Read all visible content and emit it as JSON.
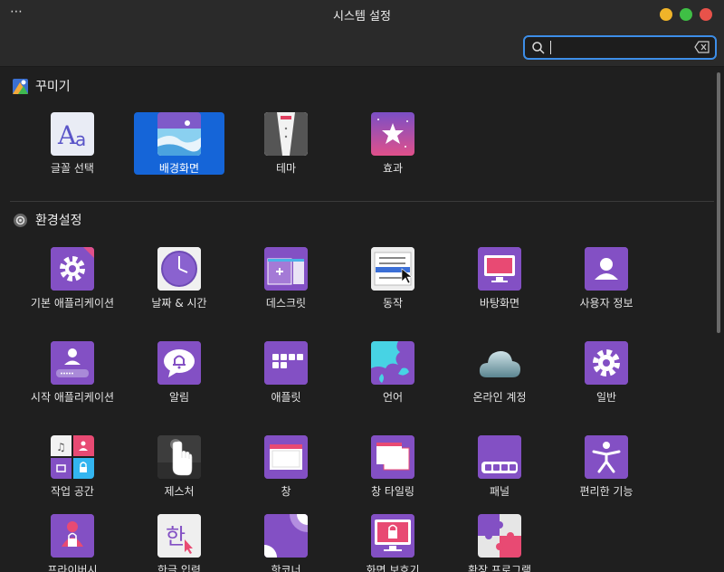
{
  "window": {
    "menu_label": "⋯",
    "title": "시스템 설정"
  },
  "search": {
    "value": "",
    "placeholder": ""
  },
  "sections": {
    "appearance": {
      "title": "꾸미기",
      "items": [
        {
          "label": "글꼴 선택",
          "icon": "font-aa-icon"
        },
        {
          "label": "배경화면",
          "icon": "wallpaper-icon",
          "selected": true
        },
        {
          "label": "테마",
          "icon": "tuxedo-theme-icon"
        },
        {
          "label": "효과",
          "icon": "star-effects-icon"
        }
      ]
    },
    "preferences": {
      "title": "환경설정",
      "items": [
        {
          "label": "기본 애플리케이션",
          "icon": "default-apps-gear-icon"
        },
        {
          "label": "날짜 & 시간",
          "icon": "clock-icon"
        },
        {
          "label": "데스크릿",
          "icon": "desklet-icon"
        },
        {
          "label": "동작",
          "icon": "actions-list-icon"
        },
        {
          "label": "바탕화면",
          "icon": "desktop-monitor-icon"
        },
        {
          "label": "사용자 정보",
          "icon": "user-info-icon"
        },
        {
          "label": "시작 애플리케이션",
          "icon": "startup-apps-icon"
        },
        {
          "label": "알림",
          "icon": "notification-bell-icon"
        },
        {
          "label": "애플릿",
          "icon": "applets-icon"
        },
        {
          "label": "언어",
          "icon": "language-map-icon"
        },
        {
          "label": "온라인 계정",
          "icon": "online-accounts-cloud-icon"
        },
        {
          "label": "일반",
          "icon": "general-gear-icon"
        },
        {
          "label": "작업 공간",
          "icon": "workspaces-icon"
        },
        {
          "label": "제스처",
          "icon": "gesture-hand-icon"
        },
        {
          "label": "창",
          "icon": "window-icon"
        },
        {
          "label": "창 타일링",
          "icon": "window-tiling-icon"
        },
        {
          "label": "패널",
          "icon": "panel-icon"
        },
        {
          "label": "편리한 기능",
          "icon": "accessibility-icon"
        },
        {
          "label": "프라이버시",
          "icon": "privacy-icon"
        },
        {
          "label": "한글 입력",
          "icon": "hangul-input-icon"
        },
        {
          "label": "핫코너",
          "icon": "hot-corner-icon"
        },
        {
          "label": "화면 보호기",
          "icon": "screensaver-icon"
        },
        {
          "label": "확장 프로그램",
          "icon": "extensions-puzzle-icon"
        }
      ]
    }
  },
  "colors": {
    "accent": "#1565d8",
    "icon_purple": "#8350c4",
    "search_border": "#3d8ee8"
  }
}
